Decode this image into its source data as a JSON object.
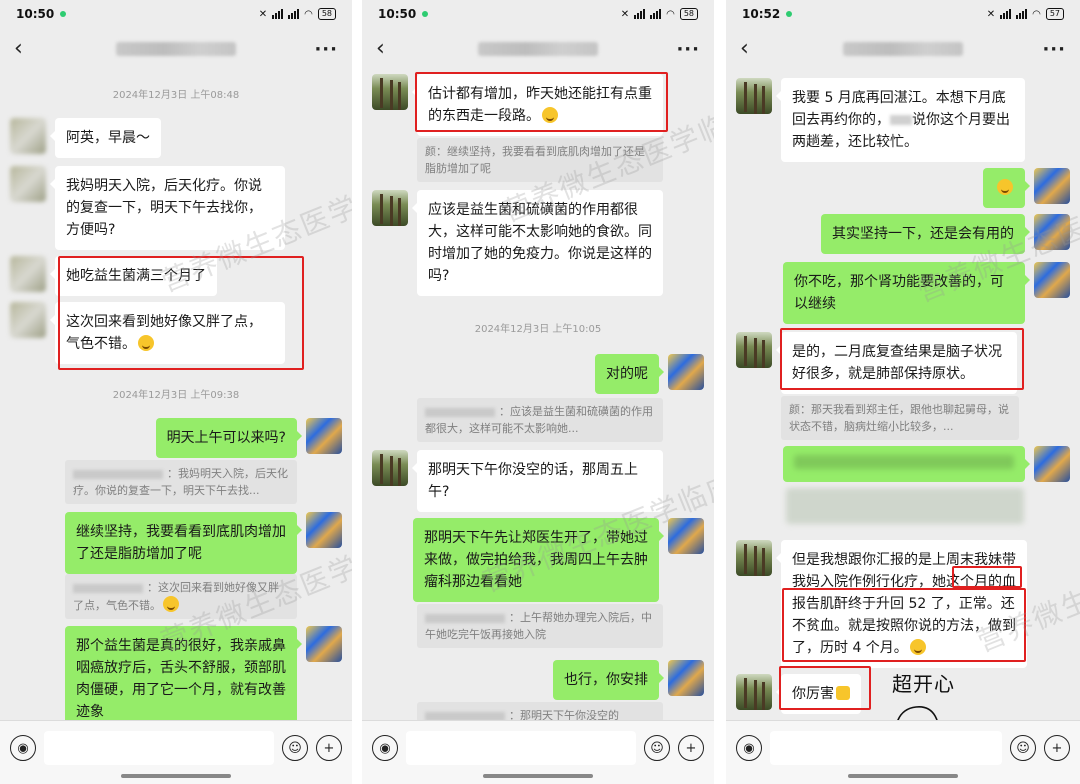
{
  "watermark": "营养微生态医学临床案例",
  "panels": [
    {
      "status_time": "10:50",
      "battery": "58",
      "messages": {
        "ts1": "2024年12月3日 上午08:48",
        "m1": "阿英，早晨～",
        "m2": "我妈明天入院，后天化疗。你说的复查一下，明天下午去找你，方便吗?",
        "m3": "她吃益生菌满三个月了",
        "m4": "这次回来看到她好像又胖了点，气色不错。",
        "ts2": "2024年12月3日 上午09:38",
        "m5": "明天上午可以来吗?",
        "q1": "：我妈明天入院，后天化疗。你说的复查一下，明天下午去找...",
        "m6": "继续坚持，我要看看到底肌肉增加了还是脂肪增加了呢",
        "q2": "：这次回来看到她好像又胖了点，气色不错。",
        "m7": "那个益生菌是真的很好，我亲戚鼻咽癌放疗后，舌头不舒服，颈部肌肉僵硬，用了它一个月，就有改善迹象"
      }
    },
    {
      "status_time": "10:50",
      "battery": "58",
      "messages": {
        "m1": "估计都有增加，昨天她还能扛有点重的东西走一段路。",
        "q1": "颜：继续坚持，我要看看到底肌肉增加了还是脂肪增加了呢",
        "m2": "应该是益生菌和硫磺菌的作用都很大，这样可能不太影响她的食欲。同时增加了她的免疫力。你说是这样的吗?",
        "ts1": "2024年12月3日 上午10:05",
        "m3": "对的呢",
        "q2": "：应该是益生菌和硫磺菌的作用都很大，这样可能不太影响她...",
        "m4": "那明天下午你没空的话，那周五上午?",
        "m5": "那明天下午先让郑医生开了，带她过来做，做完拍给我，我周四上午去肿瘤科那边看看她",
        "q3": "：上午帮她办理完入院后，中午她吃完午饭再接她入院",
        "m6": "也行，你安排",
        "q4": "：那明天下午你没空的"
      }
    },
    {
      "status_time": "10:52",
      "battery": "57",
      "messages": {
        "m1a": "我要 5 月底再回湛江。本想下月底回去再约你的，",
        "m1b": "说你这个月要出两趟差，还比较忙。",
        "m3": "其实坚持一下，还是会有用的",
        "m4": "你不吃，那个肾功能要改善的，可以继续",
        "m5": "是的，二月底复查结果是脑子状况好很多，就是肺部保持原状。",
        "q1": "颜：那天我看到郑主任，跟他也聊起舅母，说状态不错，脑病灶缩小比较多，...",
        "m6": "但是我想跟你汇报的是上周末我妹带我妈入院作例行化疗，她这个月的血报告肌酐终于升回 52 了，正常。还不贫血。就是按照你说的方法，做到了，历时 4 个月。",
        "m7": "你厉害",
        "doodle": "超开心"
      }
    }
  ]
}
